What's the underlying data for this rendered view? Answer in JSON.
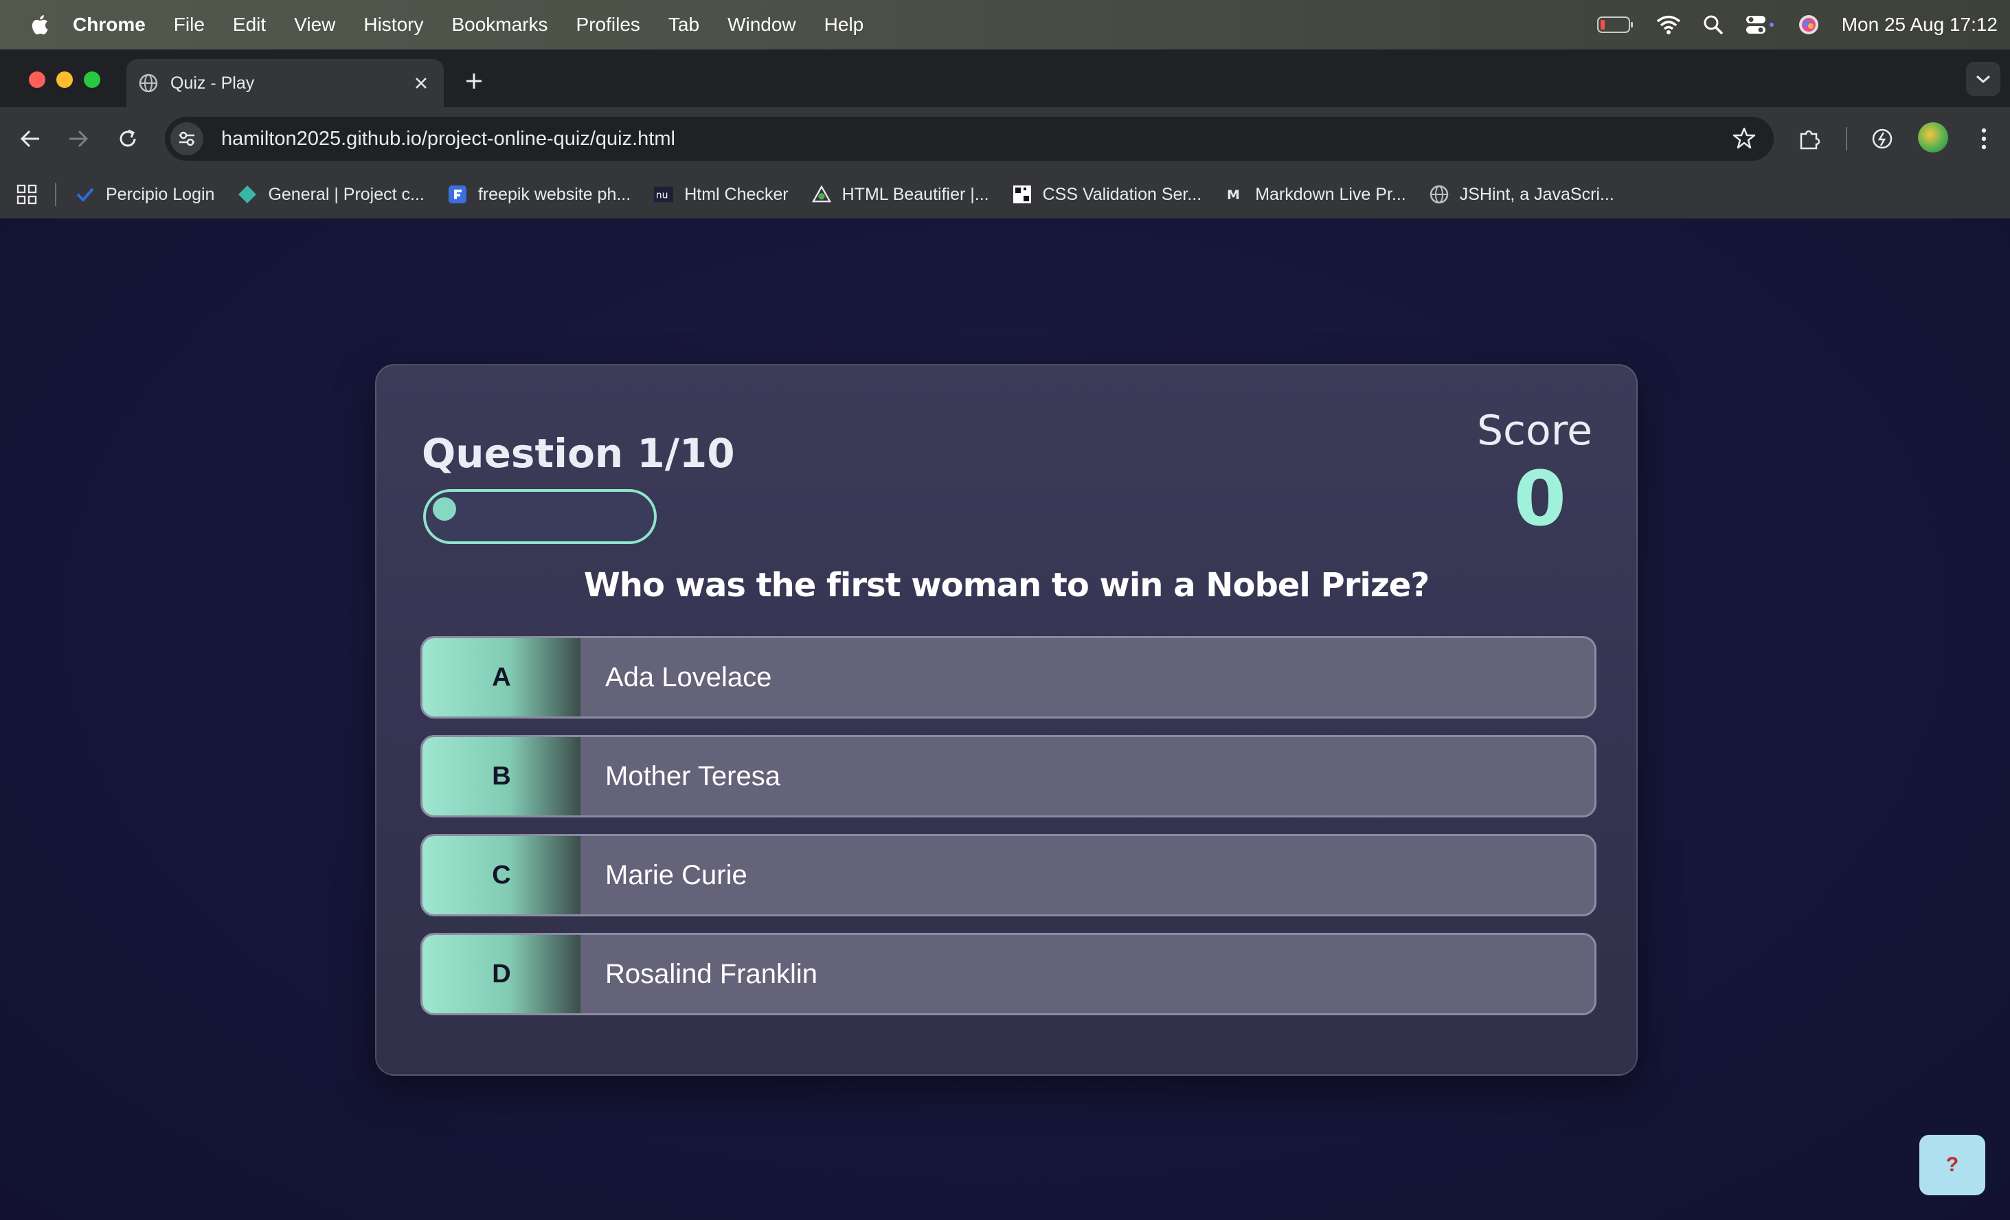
{
  "menubar": {
    "items": [
      "Chrome",
      "File",
      "Edit",
      "View",
      "History",
      "Bookmarks",
      "Profiles",
      "Tab",
      "Window",
      "Help"
    ],
    "clock": "Mon 25 Aug  17:12"
  },
  "browser": {
    "tab_title": "Quiz - Play",
    "url": "hamilton2025.github.io/project-online-quiz/quiz.html",
    "bookmarks": [
      {
        "label": "Percipio Login",
        "icon": "check-icon"
      },
      {
        "label": "General | Project c...",
        "icon": "diamond-icon"
      },
      {
        "label": "freepik website ph...",
        "icon": "freepik-icon"
      },
      {
        "label": "Html Checker",
        "icon": "nu-icon"
      },
      {
        "label": "HTML Beautifier |...",
        "icon": "beautifier-icon"
      },
      {
        "label": "CSS Validation Ser...",
        "icon": "css-validation-icon"
      },
      {
        "label": "Markdown Live Pr...",
        "icon": "markdown-icon"
      },
      {
        "label": "JSHint, a JavaScri...",
        "icon": "globe-icon"
      }
    ]
  },
  "quiz": {
    "question_counter": "Question 1/10",
    "progress_fraction": 0.1,
    "score_label": "Score",
    "score_value": "0",
    "question": "Who was the first woman to win a Nobel Prize?",
    "answers": [
      {
        "letter": "A",
        "text": "Ada Lovelace"
      },
      {
        "letter": "B",
        "text": "Mother Teresa"
      },
      {
        "letter": "C",
        "text": "Marie Curie"
      },
      {
        "letter": "D",
        "text": "Rosalind Franklin"
      }
    ],
    "help_label": "?"
  },
  "colors": {
    "accent": "#9ff1d9",
    "card": "#353452",
    "answer_bg": "#65637a",
    "page_bg": "#16163a"
  }
}
